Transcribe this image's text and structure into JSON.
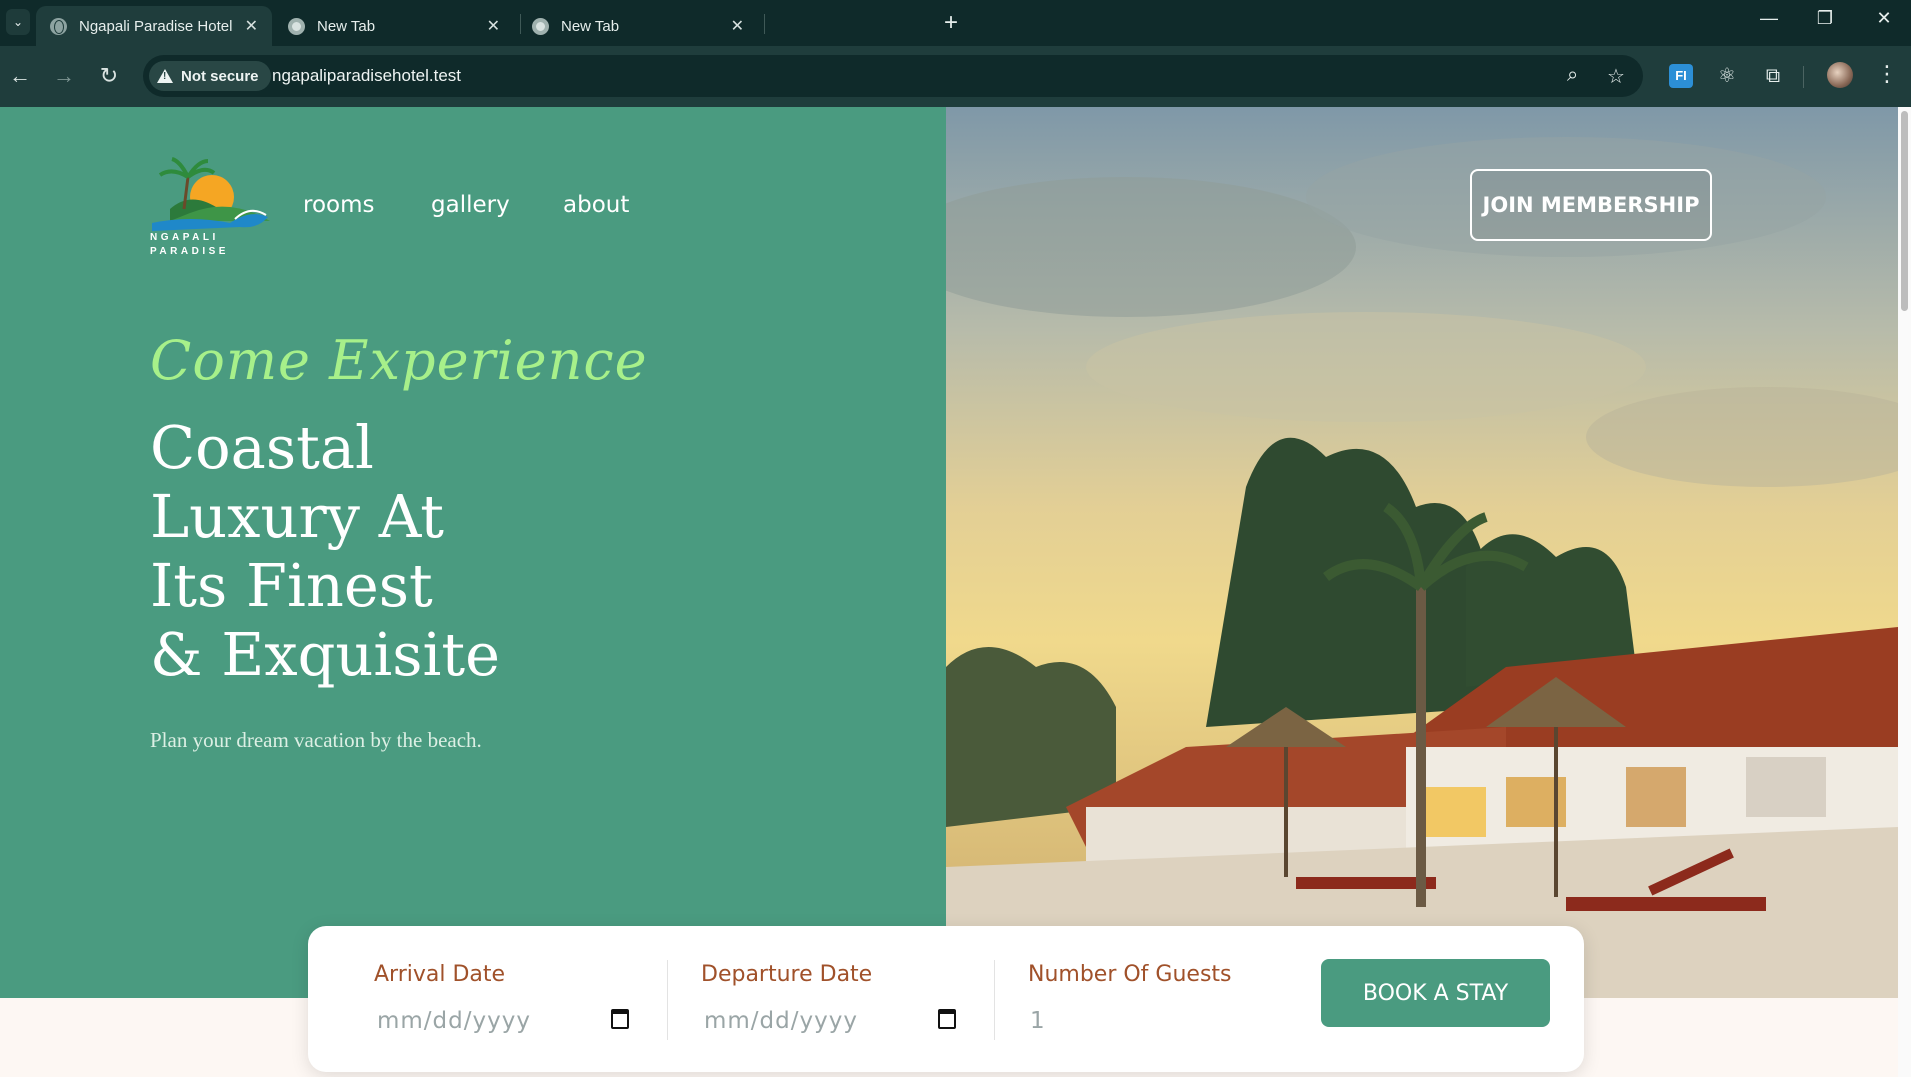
{
  "browser": {
    "tabs": [
      {
        "title": "Ngapali Paradise Hotel | Your G",
        "active": true,
        "favicon": "globe-icon"
      },
      {
        "title": "New Tab",
        "active": false,
        "favicon": "chrome-icon"
      },
      {
        "title": "New Tab",
        "active": false,
        "favicon": "chrome-icon"
      }
    ],
    "security_label": "Not secure",
    "url": "ngapaliparadisehotel.test"
  },
  "site": {
    "logo_text": "NGAPALI\nPARADISE",
    "nav": [
      {
        "label": "rooms"
      },
      {
        "label": "gallery"
      },
      {
        "label": "about"
      }
    ],
    "membership_label": "JOIN MEMBERSHIP"
  },
  "hero": {
    "script_title": "Come Experience",
    "headline": [
      "Coastal",
      "Luxury At",
      "Its Finest",
      "& Exquisite"
    ],
    "subtitle": "Plan your dream vacation by the beach."
  },
  "booking": {
    "arrival": {
      "label": "Arrival Date",
      "placeholder": "mm/dd/yyyy"
    },
    "departure": {
      "label": "Departure Date",
      "placeholder": "mm/dd/yyyy"
    },
    "guests": {
      "label": "Number Of Guests",
      "value": "1"
    },
    "submit_label": "BOOK A STAY"
  },
  "colors": {
    "primary_green": "#4a9b80",
    "script_green": "#a7f08a",
    "label_brown": "#a0512a",
    "browser_dark": "#0f2a2a"
  }
}
